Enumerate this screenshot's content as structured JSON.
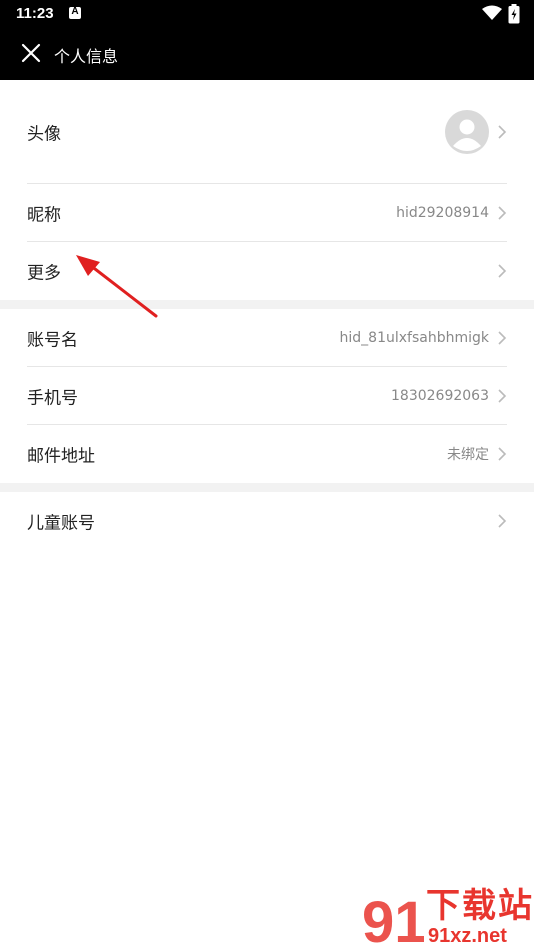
{
  "status_bar": {
    "time": "11:23",
    "notification_badge": "A"
  },
  "header": {
    "title": "个人信息"
  },
  "sections": [
    {
      "items": [
        {
          "label": "头像",
          "value": ""
        },
        {
          "label": "昵称",
          "value": "hid29208914"
        },
        {
          "label": "更多",
          "value": ""
        }
      ]
    },
    {
      "items": [
        {
          "label": "账号名",
          "value": "hid_81ulxfsahbhmigk"
        },
        {
          "label": "手机号",
          "value": "18302692063"
        },
        {
          "label": "邮件地址",
          "value": "未绑定"
        }
      ]
    },
    {
      "items": [
        {
          "label": "儿童账号",
          "value": ""
        }
      ]
    }
  ],
  "watermark": {
    "logo_text": "91",
    "title": "下载站",
    "site": "91xz.net"
  },
  "colors": {
    "bar": "#000000",
    "accent": "#e8352e",
    "divider": "#e6e6e6",
    "secondary_text": "#888888"
  }
}
